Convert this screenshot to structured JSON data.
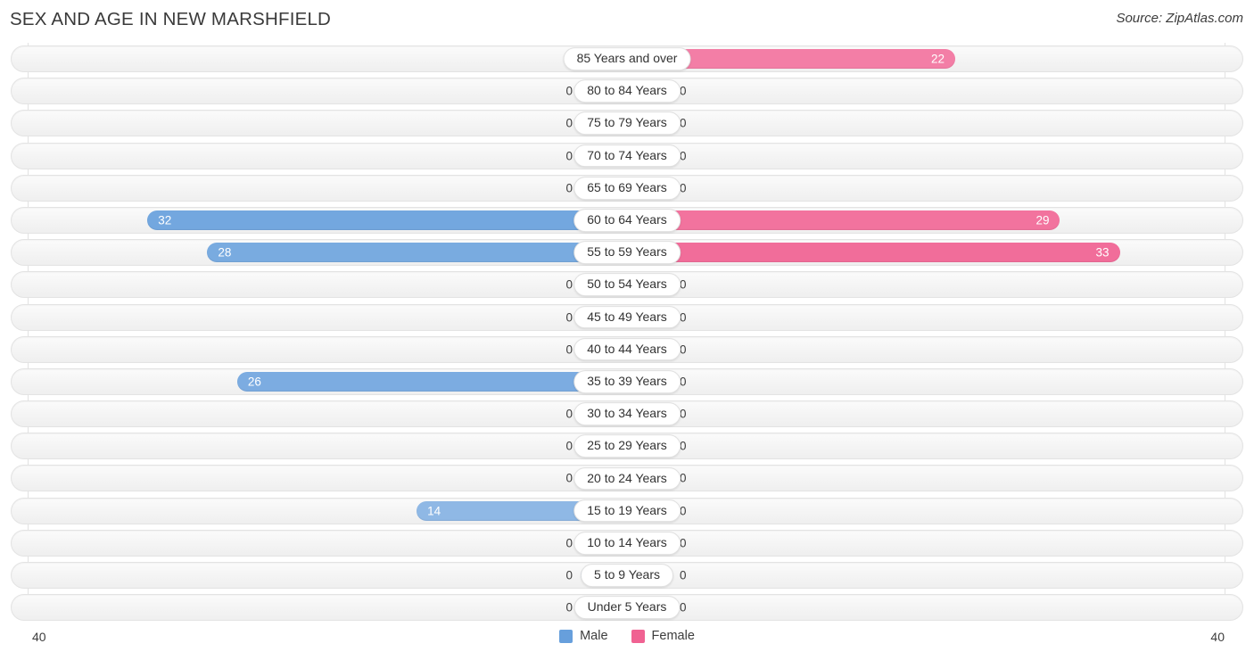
{
  "header": {
    "title": "SEX AND AGE IN NEW MARSHFIELD",
    "source": "Source: ZipAtlas.com"
  },
  "legend": {
    "male_label": "Male",
    "female_label": "Female",
    "male_color": "#679FDC",
    "female_color": "#F06292"
  },
  "axis": {
    "left_max": "40",
    "right_max": "40"
  },
  "chart_data": {
    "type": "bar",
    "subtype": "population-pyramid",
    "title": "SEX AND AGE IN NEW MARSHFIELD",
    "xlabel": "",
    "ylabel": "",
    "xlim": [
      40,
      40
    ],
    "axis_max": 40,
    "grid": true,
    "legend_position": "bottom-center",
    "categories": [
      "85 Years and over",
      "80 to 84 Years",
      "75 to 79 Years",
      "70 to 74 Years",
      "65 to 69 Years",
      "60 to 64 Years",
      "55 to 59 Years",
      "50 to 54 Years",
      "45 to 49 Years",
      "40 to 44 Years",
      "35 to 39 Years",
      "30 to 34 Years",
      "25 to 29 Years",
      "20 to 24 Years",
      "15 to 19 Years",
      "10 to 14 Years",
      "5 to 9 Years",
      "Under 5 Years"
    ],
    "series": [
      {
        "name": "Male",
        "color": "#679FDC",
        "values": [
          0,
          0,
          0,
          0,
          0,
          32,
          28,
          0,
          0,
          0,
          26,
          0,
          0,
          0,
          14,
          0,
          0,
          0
        ]
      },
      {
        "name": "Female",
        "color": "#F06292",
        "values": [
          22,
          0,
          0,
          0,
          0,
          29,
          33,
          0,
          0,
          0,
          0,
          0,
          0,
          0,
          0,
          0,
          0,
          0
        ]
      }
    ]
  }
}
